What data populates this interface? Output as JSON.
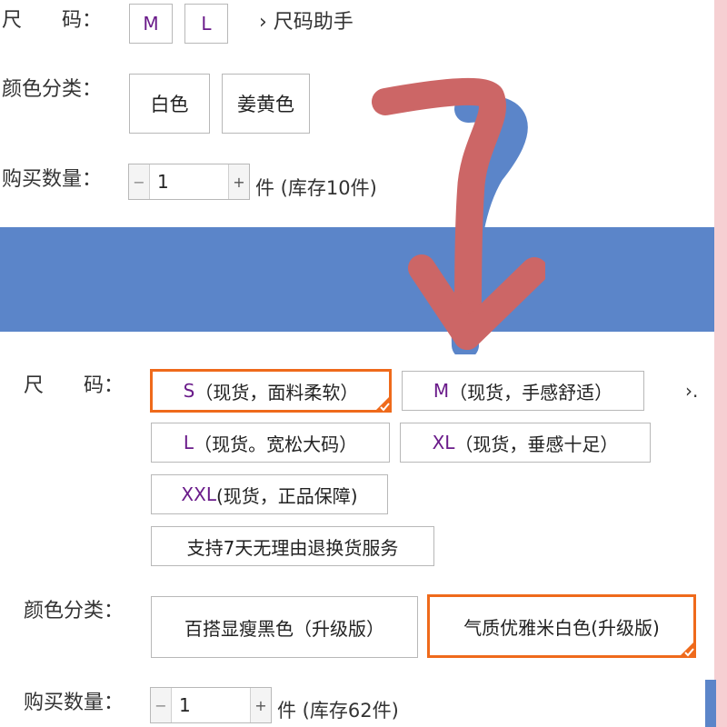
{
  "top": {
    "size_label": "尺　　码：",
    "sizes": [
      "M",
      "L"
    ],
    "size_helper": "› 尺码助手",
    "color_label": "颜色分类：",
    "colors": [
      "白色",
      "姜黄色"
    ],
    "qty_label": "购买数量：",
    "qty_minus": "−",
    "qty_value": "1",
    "qty_plus": "+",
    "stock_text": "件 (库存10件)"
  },
  "bottom": {
    "size_label": "尺　　码：",
    "sizes": [
      {
        "code": "S",
        "desc": "（现货，面料柔软）",
        "selected": true
      },
      {
        "code": "M",
        "desc": "（现货，手感舒适）",
        "selected": false
      },
      {
        "code": "L",
        "desc": "（现货。宽松大码）",
        "selected": false
      },
      {
        "code": "XL",
        "desc": "（现货，垂感十足）",
        "selected": false
      },
      {
        "code": "XXL",
        "desc": "(现货，正品保障)",
        "selected": false
      }
    ],
    "more_indicator": "›.",
    "service_option": "支持7天无理由退换货服务",
    "color_label": "颜色分类：",
    "colors": [
      {
        "label": "百搭显瘦黑色（升级版）",
        "selected": false
      },
      {
        "label": "气质优雅米白色(升级版)",
        "selected": true
      }
    ],
    "qty_label": "购买数量：",
    "qty_minus": "−",
    "qty_value": "1",
    "qty_plus": "+",
    "stock_text": "件 (库存62件)"
  },
  "colors": {
    "band": "#5b85c9",
    "arrow": "#cc6666",
    "arrow_shadow": "#5b85c9",
    "selected_border": "#ef6a1b",
    "side_strip": "#f6cfd2"
  },
  "icons": {
    "arrow": "red-hand-drawn-arrow-icon",
    "check": "check-corner-icon"
  }
}
